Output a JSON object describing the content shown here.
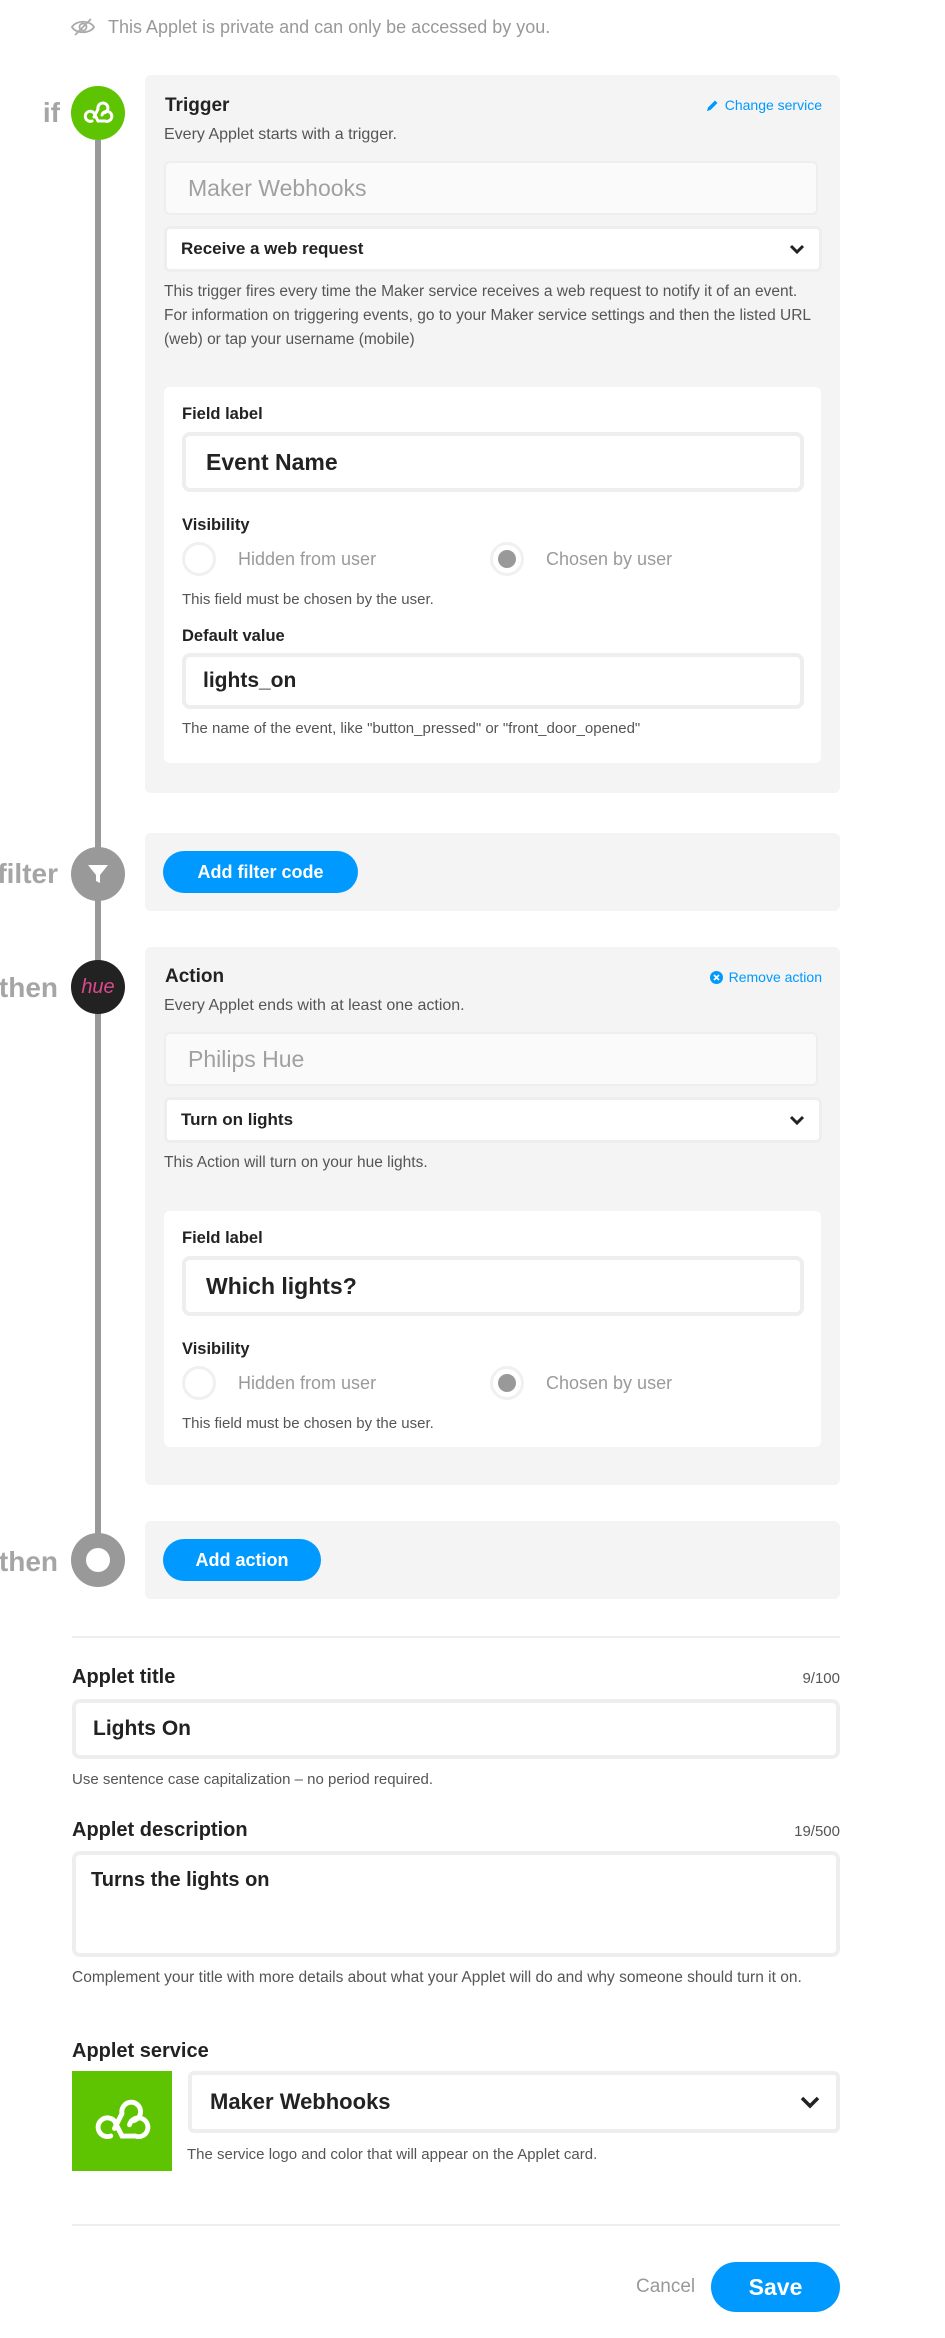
{
  "private_notice": "This Applet is private and can only be accessed by you.",
  "colors": {
    "accent": "#0099ff",
    "webhooks_green": "#5ec300",
    "timeline_gray": "#999999"
  },
  "trigger": {
    "step_word": "if",
    "title": "Trigger",
    "change_service": "Change service",
    "subtitle": "Every Applet starts with a trigger.",
    "service_name": "Maker Webhooks",
    "selected_trigger": "Receive a web request",
    "description": "This trigger fires every time the Maker service receives a web request to notify it of an event. For information on triggering events, go to your Maker service settings and then the listed URL (web) or tap your username (mobile)",
    "field_label_title": "Field label",
    "field_label_value": "Event Name",
    "visibility_title": "Visibility",
    "hidden_label": "Hidden from user",
    "chosen_label": "Chosen by user",
    "visibility_hint": "This field must be chosen by the user.",
    "default_value_title": "Default value",
    "default_value": "lights_on",
    "default_hint": "The name of the event, like \"button_pressed\" or \"front_door_opened\""
  },
  "filter": {
    "step_word": "filter",
    "button": "Add filter code"
  },
  "action": {
    "step_word": "then",
    "logo_text": "hue",
    "title": "Action",
    "remove": "Remove action",
    "subtitle": "Every Applet ends with at least one action.",
    "service_name": "Philips Hue",
    "selected_action": "Turn on lights",
    "description": "This Action will turn on your hue lights.",
    "field_label_title": "Field label",
    "field_label_value": "Which lights?",
    "visibility_title": "Visibility",
    "hidden_label": "Hidden from user",
    "chosen_label": "Chosen by user",
    "visibility_hint": "This field must be chosen by the user."
  },
  "add_action": {
    "step_word": "then",
    "button": "Add action"
  },
  "applet_title": {
    "label": "Applet title",
    "counter": "9/100",
    "value": "Lights On",
    "hint": "Use sentence case capitalization – no period required."
  },
  "applet_description": {
    "label": "Applet description",
    "counter": "19/500",
    "value": "Turns the lights on",
    "hint": "Complement your title with more details about what your Applet will do and why someone should turn it on."
  },
  "applet_service": {
    "label": "Applet service",
    "selected": "Maker Webhooks",
    "hint": "The service logo and color that will appear on the Applet card."
  },
  "footer": {
    "cancel": "Cancel",
    "save": "Save"
  }
}
